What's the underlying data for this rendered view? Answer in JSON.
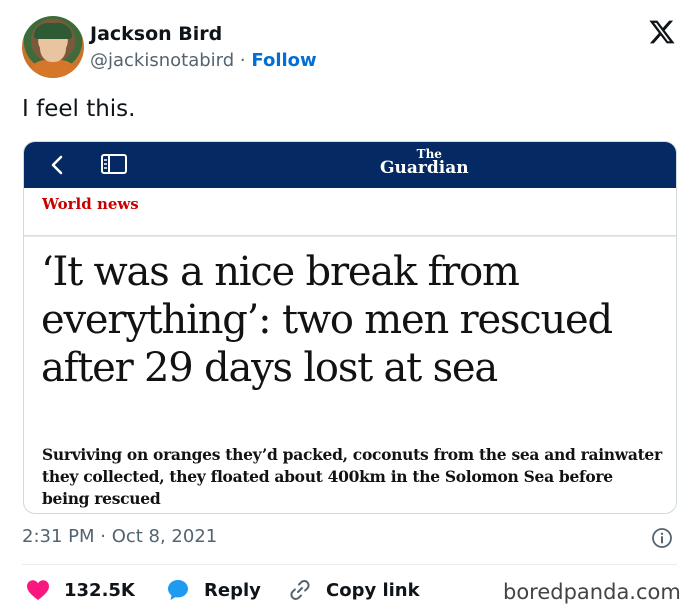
{
  "author": {
    "name": "Jackson Bird",
    "handle": "@jackisnotabird",
    "separator": "·",
    "follow_label": "Follow"
  },
  "tweet": {
    "text": "I feel this.",
    "timestamp": "2:31 PM · Oct 8, 2021"
  },
  "article": {
    "publisher_the": "The",
    "publisher_name": "Guardian",
    "section": "World news",
    "headline": "‘It was a nice break from everything’: two men rescued after 29 days lost at sea",
    "standfirst": "Surviving on oranges they’d packed, coconuts from the sea and rainwater they collected, they floated about 400km in the Solomon Sea before being rescued"
  },
  "actions": {
    "like_count": "132.5K",
    "reply_label": "Reply",
    "copy_label": "Copy link"
  },
  "watermark": "boredpanda.com",
  "colors": {
    "follow": "#006fd6",
    "guardian_bar": "#052962",
    "section": "#c70000",
    "like": "#f91880",
    "reply": "#1d9bf0"
  },
  "icons": [
    "x-logo-icon",
    "back-icon",
    "reader-mode-icon",
    "info-icon",
    "heart-icon",
    "reply-bubble-icon",
    "link-icon"
  ]
}
